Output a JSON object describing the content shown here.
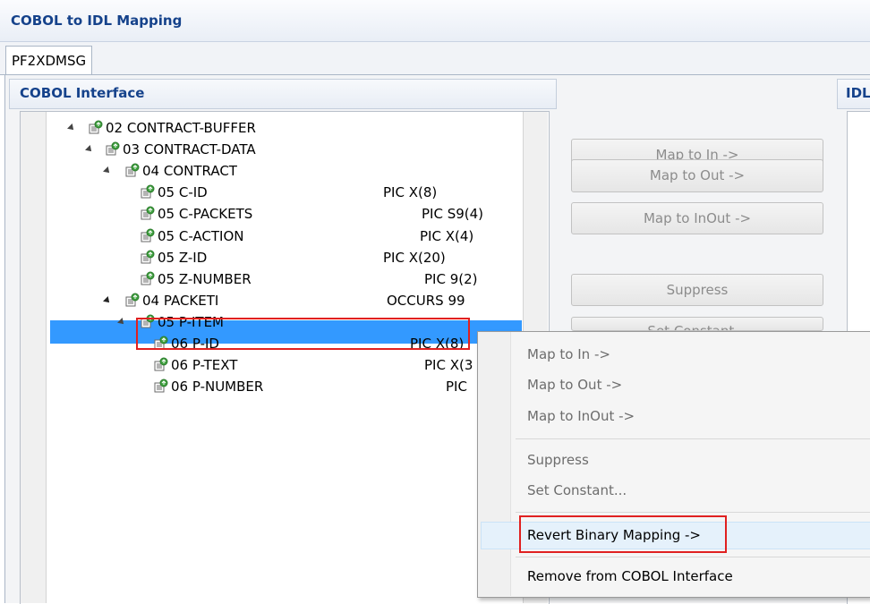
{
  "window": {
    "title": "COBOL to IDL Mapping"
  },
  "tabs": [
    {
      "label": "PF2XDMSG"
    }
  ],
  "panels": {
    "cobol_interface": "COBOL Interface",
    "idl_interface": "IDL Interface"
  },
  "tree": [
    {
      "level": "02",
      "name": "02 CONTRACT-BUFFER",
      "pic": "",
      "expanded": true
    },
    {
      "level": "03",
      "name": "03 CONTRACT-DATA",
      "pic": "",
      "expanded": true
    },
    {
      "level": "04",
      "name": "04 CONTRACT",
      "pic": "",
      "expanded": true
    },
    {
      "level": "05",
      "name": "05 C-ID",
      "pic": "PIC X(8)"
    },
    {
      "level": "05",
      "name": "05 C-PACKETS",
      "pic": "PIC S9(4)"
    },
    {
      "level": "05",
      "name": "05 C-ACTION",
      "pic": "PIC X(4)"
    },
    {
      "level": "05",
      "name": "05 Z-ID",
      "pic": "PIC X(20)"
    },
    {
      "level": "05",
      "name": "05 Z-NUMBER",
      "pic": "PIC 9(2)"
    },
    {
      "level": "04",
      "name": "04 PACKETI",
      "pic": "OCCURS 99",
      "expanded": true,
      "selected": true
    },
    {
      "level": "05",
      "name": "05 P-ITEM",
      "pic": "",
      "expanded": true
    },
    {
      "level": "06",
      "name": "06 P-ID",
      "pic": "PIC X(8)"
    },
    {
      "level": "06",
      "name": "06 P-TEXT",
      "pic": "PIC X(3"
    },
    {
      "level": "06",
      "name": "06 P-NUMBER",
      "pic": "PIC"
    }
  ],
  "buttons": {
    "map_in": "Map to In ->",
    "map_out": "Map to Out ->",
    "map_inout": "Map to InOut ->",
    "suppress": "Suppress",
    "set_constant": "Set Constant..."
  },
  "context_menu": {
    "items": [
      {
        "label": "Map to In ->",
        "enabled": false
      },
      {
        "label": "Map to Out ->",
        "enabled": false
      },
      {
        "label": "Map to InOut ->",
        "enabled": false
      },
      {
        "label": "Suppress",
        "enabled": false
      },
      {
        "label": "Set Constant...",
        "enabled": false
      },
      {
        "label": "Revert Binary Mapping ->",
        "enabled": true,
        "highlighted": true
      },
      {
        "label": "Remove from COBOL Interface",
        "enabled": true
      }
    ]
  },
  "colors": {
    "selection": "#3399ff",
    "callout": "#e02020",
    "header_text": "#15428b"
  },
  "icons": {
    "tree_node": "cobol-field-icon",
    "expand": "expand-arrow-icon"
  }
}
